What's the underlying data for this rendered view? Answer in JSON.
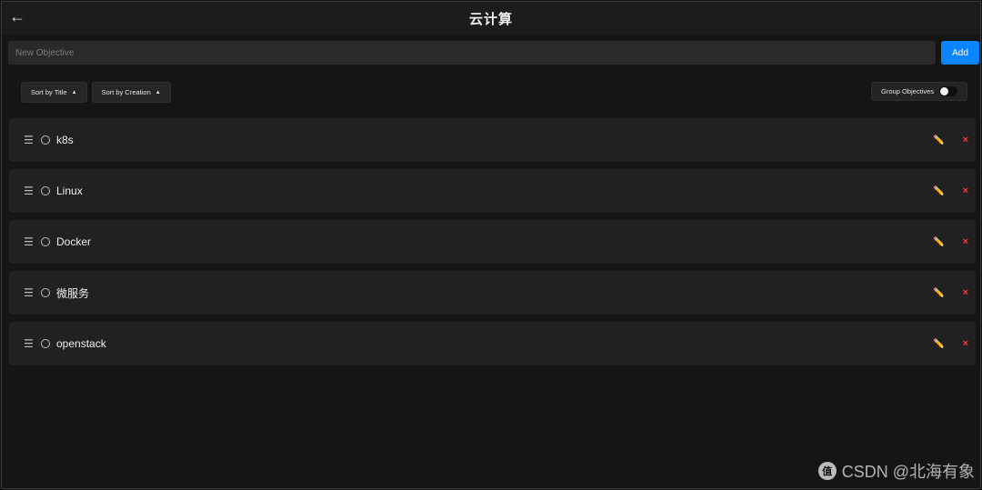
{
  "header": {
    "back_icon": "←",
    "title": "云计算"
  },
  "input": {
    "placeholder": "New Objective",
    "value": ""
  },
  "add_button": {
    "label": "Add"
  },
  "sort": [
    {
      "label": "Sort by Title",
      "direction": "▲"
    },
    {
      "label": "Sort by Creation",
      "direction": "▲"
    }
  ],
  "group_toggle": {
    "label": "Group Objectives",
    "enabled": false
  },
  "objectives": [
    {
      "title": "k8s"
    },
    {
      "title": "Linux"
    },
    {
      "title": "Docker"
    },
    {
      "title": "微服务"
    },
    {
      "title": "openstack"
    }
  ],
  "icons": {
    "drag": "☰",
    "edit": "✏️",
    "delete": "×"
  },
  "watermark": {
    "text": "CSDN @北海有象",
    "logo": "值"
  }
}
